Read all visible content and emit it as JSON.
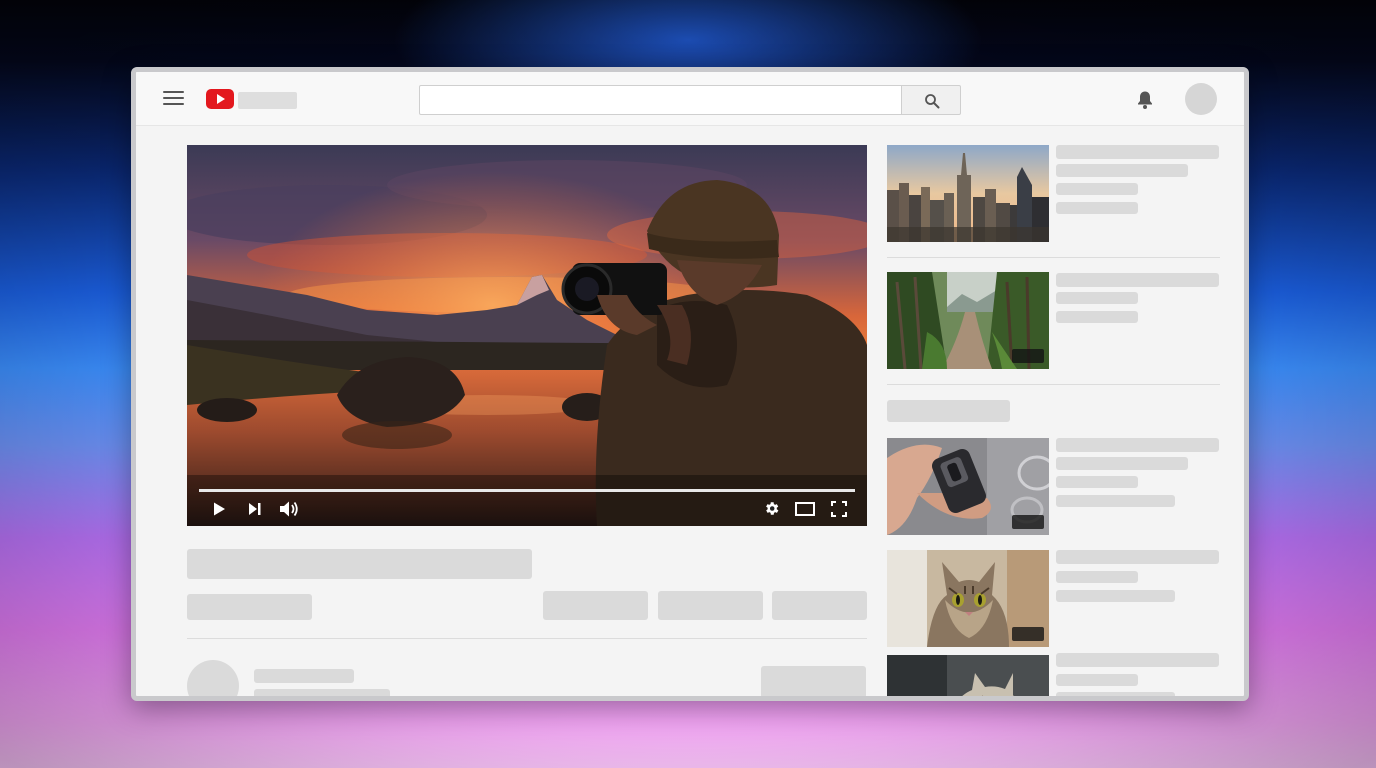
{
  "app": {
    "name": "YouTube",
    "logo_icon": "youtube-logo-icon"
  },
  "colors": {
    "brand_red": "#e3181e",
    "skeleton": "#dadada",
    "page_bg": "#f4f4f4"
  },
  "header": {
    "search": {
      "placeholder": "",
      "value": ""
    },
    "icons": [
      "menu-icon",
      "search-icon",
      "notifications-bell-icon",
      "account-avatar"
    ]
  },
  "player": {
    "progress_fraction": 1.0,
    "controls": [
      "play-icon",
      "next-icon",
      "volume-icon",
      "settings-gear-icon",
      "theater-mode-icon",
      "fullscreen-icon"
    ]
  },
  "recommendations": [
    {
      "thumbnail": "city-skyline-sunset",
      "has_duration_badge": false
    },
    {
      "thumbnail": "forest-trail",
      "has_duration_badge": true
    },
    {
      "thumbnail": "hand-holding-device",
      "has_duration_badge": true
    },
    {
      "thumbnail": "tabby-cat",
      "has_duration_badge": true
    },
    {
      "thumbnail": "cat-partial",
      "has_duration_badge": false
    }
  ]
}
